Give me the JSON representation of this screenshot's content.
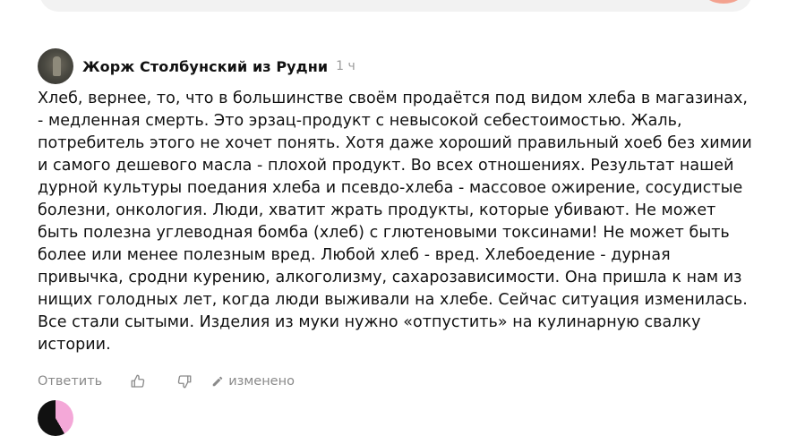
{
  "comment": {
    "author": "Жорж Столбунский из Рудни",
    "time": "1 ч",
    "text": "Хлеб, вернее, то, что в большинстве своём продаётся под видом хлеба в магазинах, - медленная смерть. Это эрзац-продукт с невысокой себестоимостью. Жаль, потребитель этого не хочет понять. Хотя даже хороший правильный хоеб без химии и самого дешевого масла - плохой продукт. Во всех отношениях. Результат нашей дурной культуры поедания хлеба и псевдо-хлеба - массовое ожирение, сосудистые болезни, онкология. Люди, хватит жрать продукты, которые убивают. Не может быть полезна углеводная бомба (хлеб) с глютеновыми токсинами! Не может быть более или менее полезным вред. Любой хлеб - вред. Хлебоедение - дурная привычка, сродни курению, алкоголизму, сахарозависимости. Она пришла к нам из нищих голодных лет, когда люди выживали на хлебе. Сейчас ситуация изменилась. Все стали сытыми. Изделия из муки нужно «отпустить» на кулинарную свалку истории.",
    "actions": {
      "reply": "Ответить",
      "edited": "изменено"
    }
  },
  "icons": {
    "like": "thumbs-up-icon",
    "dislike": "thumbs-down-icon",
    "edited": "pencil-icon"
  },
  "colors": {
    "muted_text": "#8a8a8a",
    "send_button": "#f3a28f"
  }
}
